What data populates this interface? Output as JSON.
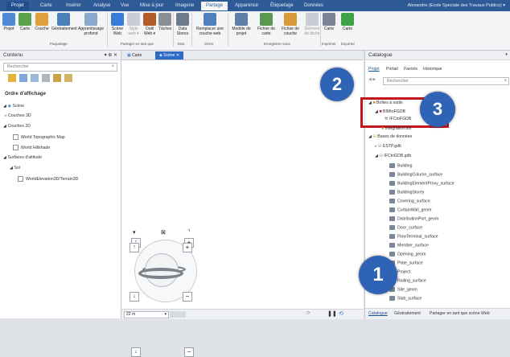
{
  "ribbon_tabs": [
    "Projet",
    "Carte",
    "Insérer",
    "Analyse",
    "Vue",
    "Mise à jour",
    "Imagerie",
    "Partage",
    "Apparence",
    "Étiquetage",
    "Données"
  ],
  "active_tab": "Partage",
  "user": "Alexandre (Ecole Speciale des Travaux Publics) ▾",
  "ribbon_buttons": {
    "b1": "Projet",
    "b2": "Carte",
    "b3": "Couche",
    "b4": "Géotraitement",
    "b5": "Apprentissage profond",
    "b6": "Scène Web",
    "b7": "Style web ▾",
    "b8": "Outil Web ▾",
    "b9": "Tâches",
    "b10": "Data Stores",
    "b11": "Remplacer une couche web",
    "b12": "Modèle de projet",
    "b13": "Fichier de carte",
    "b14": "Fichier de couche",
    "b15": "Élément de tâche",
    "b16": "Carte",
    "b17": "Carte"
  },
  "ribbon_groups": {
    "g1": "Paquetage",
    "g2": "Partager en tant que",
    "g3": "Etat",
    "g4": "Gérer",
    "g5": "Enregistrer sous",
    "g6": "Imprimer",
    "g7": "Exporter"
  },
  "contents": {
    "title": "Contenu",
    "search_placeholder": "Rechercher",
    "order_heading": "Ordre d'affichage",
    "scene": "Scène",
    "couches3d": "Couches 3D",
    "couches2d": "Couches 2D",
    "topo": "World Topographic Map",
    "hillshade": "World Hillshade",
    "surfaces": "Surfaces d'altitude",
    "sol": "Sol",
    "elevation": "WorldElevation3D/Terrain3D"
  },
  "map_tabs": {
    "carte": "Carte",
    "scene": "Scène"
  },
  "status": {
    "scale": "22 m"
  },
  "catalog": {
    "title": "Catalogue",
    "tabs": {
      "projet": "Projet",
      "portail": "Portail",
      "favoris": "Favoris",
      "historique": "Historique"
    },
    "search_placeholder": "Rechercher",
    "boites": "Boîtes à outils",
    "ifc1": "BIMtoFGDB",
    "ifc2": "IFCtoFGDB",
    "integration": "Integration.tbx",
    "bases": "Bases de données",
    "estp": "ESTP.gdb",
    "ifcgdb": "IFCtoGDB.gdb",
    "classes": [
      "Building",
      "BuildingColumn_surface",
      "BuildingElementProxy_surface",
      "BuildingStorey",
      "Covering_surface",
      "CurtainWall_geom",
      "DistributionPort_geom",
      "Door_surface",
      "FlowTerminal_surface",
      "Member_surface",
      "Opening_geom",
      "Plate_surface",
      "Project",
      "Railing_surface",
      "Site_geom",
      "Slab_surface"
    ],
    "bottom_tabs": {
      "t1": "Catalogue",
      "t2": "Géotraitement",
      "t3": "Partager en tant que scène Web"
    }
  },
  "badges": {
    "one": "1",
    "two": "2",
    "three": "3"
  },
  "colors": {
    "ribbon": "#2e5b95",
    "badge": "#2f63b6",
    "highlight": "#c0161c"
  }
}
